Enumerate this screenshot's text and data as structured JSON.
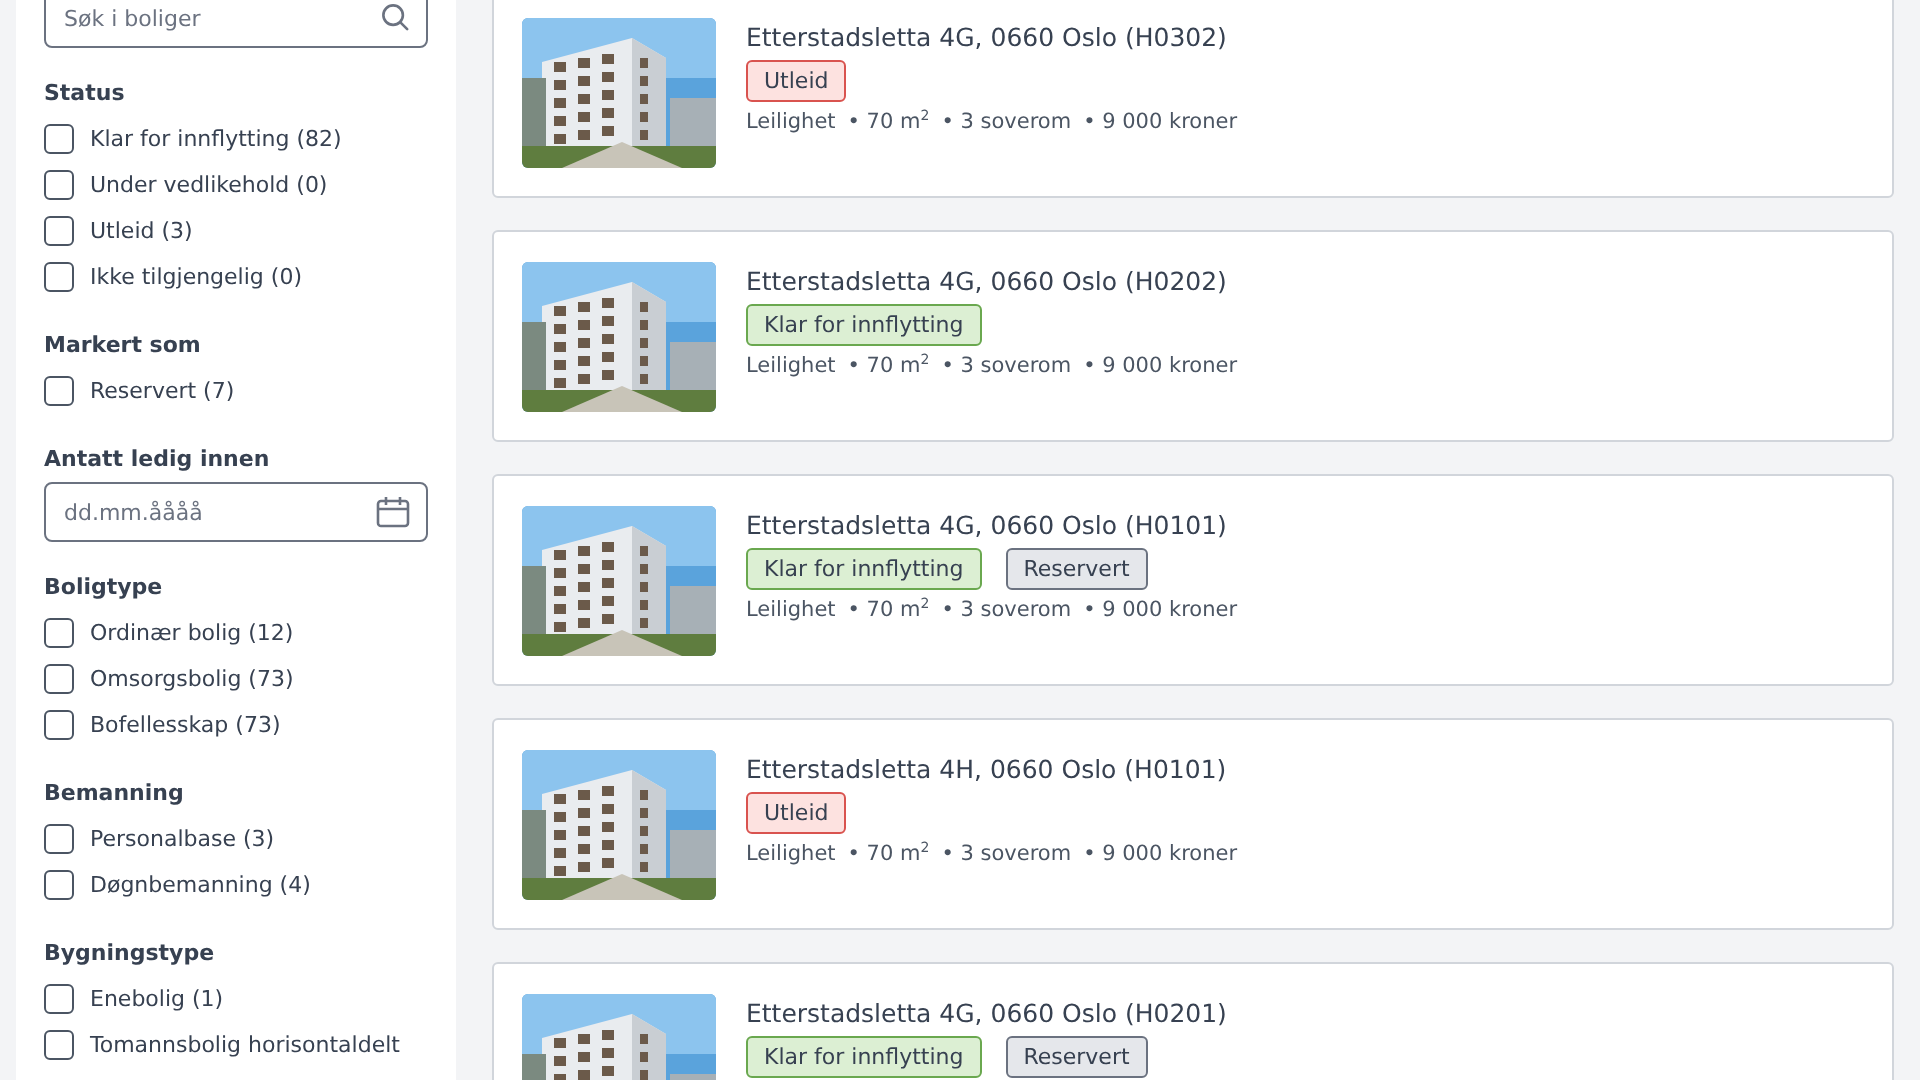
{
  "search": {
    "placeholder": "Søk i boliger"
  },
  "filters": [
    {
      "kind": "checkboxes",
      "title": "Status",
      "options": [
        {
          "label": "Klar for innflytting (82)",
          "checked": false
        },
        {
          "label": "Under vedlikehold (0)",
          "checked": false
        },
        {
          "label": "Utleid (3)",
          "checked": false
        },
        {
          "label": "Ikke tilgjengelig (0)",
          "checked": false
        }
      ]
    },
    {
      "kind": "checkboxes",
      "title": "Markert som",
      "options": [
        {
          "label": "Reservert (7)",
          "checked": false
        }
      ]
    },
    {
      "kind": "date",
      "title": "Antatt ledig innen",
      "placeholder": "dd.mm.åååå"
    },
    {
      "kind": "checkboxes",
      "title": "Boligtype",
      "options": [
        {
          "label": "Ordinær bolig (12)",
          "checked": false
        },
        {
          "label": "Omsorgsbolig (73)",
          "checked": false
        },
        {
          "label": "Bofellesskap (73)",
          "checked": false
        }
      ]
    },
    {
      "kind": "checkboxes",
      "title": "Bemanning",
      "options": [
        {
          "label": "Personalbase (3)",
          "checked": false
        },
        {
          "label": "Døgnbemanning (4)",
          "checked": false
        }
      ]
    },
    {
      "kind": "checkboxes",
      "title": "Bygningstype",
      "options": [
        {
          "label": "Enebolig (1)",
          "checked": false
        },
        {
          "label": "Tomannsbolig horisontaldelt",
          "checked": false
        }
      ]
    }
  ],
  "listings": [
    {
      "title": "Etterstadsletta 4G, 0660 Oslo (H0302)",
      "tags": [
        {
          "label": "Utleid",
          "kind": "rented"
        }
      ],
      "details": [
        "Leilighet",
        "• 70 m$^{2}$",
        "• 3 soverom",
        "• 9 000 kroner"
      ]
    },
    {
      "title": "Etterstadsletta 4G, 0660 Oslo (H0202)",
      "tags": [
        {
          "label": "Klar for innflytting",
          "kind": "ready"
        }
      ],
      "details": [
        "Leilighet",
        "• 70 m$^{2}$",
        "• 3 soverom",
        "• 9 000 kroner"
      ]
    },
    {
      "title": "Etterstadsletta 4G, 0660 Oslo (H0101)",
      "tags": [
        {
          "label": "Klar for innflytting",
          "kind": "ready"
        },
        {
          "label": "Reservert",
          "kind": "reserved"
        }
      ],
      "details": [
        "Leilighet",
        "• 70 m$^{2}$",
        "• 3 soverom",
        "• 9 000 kroner"
      ]
    },
    {
      "title": "Etterstadsletta 4H, 0660 Oslo (H0101)",
      "tags": [
        {
          "label": "Utleid",
          "kind": "rented"
        }
      ],
      "details": [
        "Leilighet",
        "• 70 m$^{2}$",
        "• 3 soverom",
        "• 9 000 kroner"
      ]
    },
    {
      "title": "Etterstadsletta 4G, 0660 Oslo (H0201)",
      "tags": [
        {
          "label": "Klar for innflytting",
          "kind": "ready"
        },
        {
          "label": "Reservert",
          "kind": "reserved"
        }
      ]
    }
  ]
}
